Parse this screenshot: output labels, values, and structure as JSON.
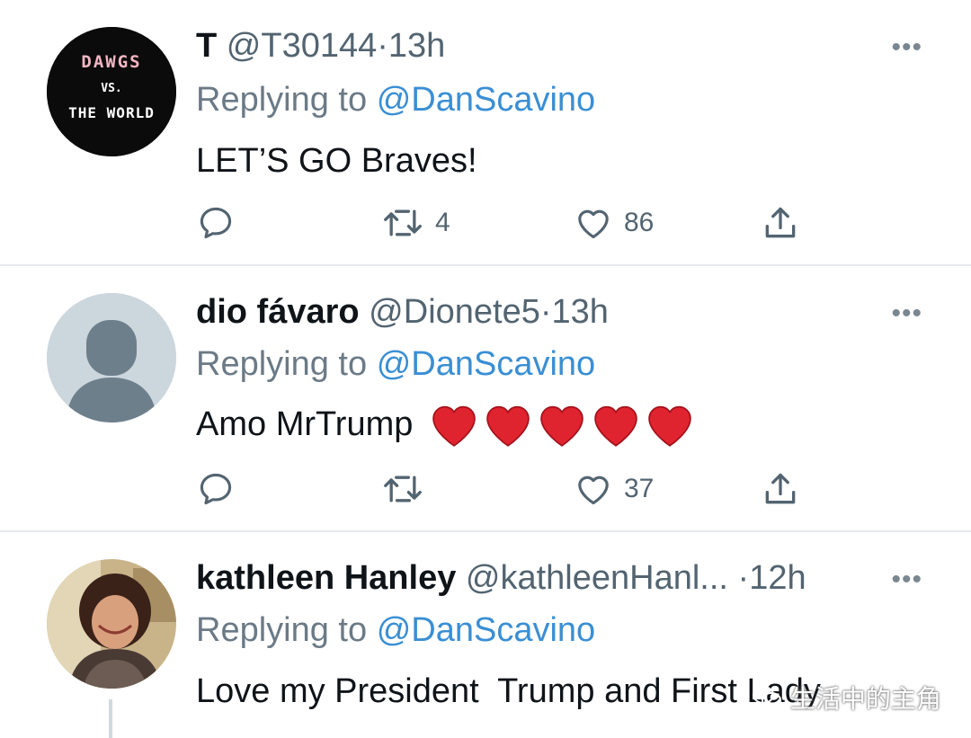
{
  "tweets": [
    {
      "name": "T",
      "handle": "@T30144",
      "dot": "·",
      "time": "13h",
      "replying_prefix": "Replying to",
      "replying_to": "@DanScavino",
      "text": "LET’S GO Braves!",
      "replies": "",
      "retweets": "4",
      "likes": "86",
      "avatar_lines": [
        "DAWGS",
        "VS.",
        "THE WORLD"
      ]
    },
    {
      "name": "dio fávaro",
      "handle": "@Dionete5",
      "dot": "·",
      "time": "13h",
      "replying_prefix": "Replying to",
      "replying_to": "@DanScavino",
      "text": "Amo MrTrump",
      "emoji_count": 5,
      "replies": "",
      "retweets": "",
      "likes": "37"
    },
    {
      "name": "kathleen Hanley",
      "handle": "@kathleenHanl...",
      "dot": "·",
      "time": "12h",
      "replying_prefix": "Replying to",
      "replying_to": "@DanScavino",
      "text": "Love my President  Trump and First Lady"
    }
  ],
  "icons": {
    "more": "more-icon",
    "reply": "reply-icon",
    "retweet": "retweet-icon",
    "like": "heart-icon",
    "share": "share-icon"
  },
  "colors": {
    "mention": "#3a8fd4",
    "secondary_text": "#536471",
    "separator": "#e6e9eb"
  },
  "watermark": "生活中的主角"
}
